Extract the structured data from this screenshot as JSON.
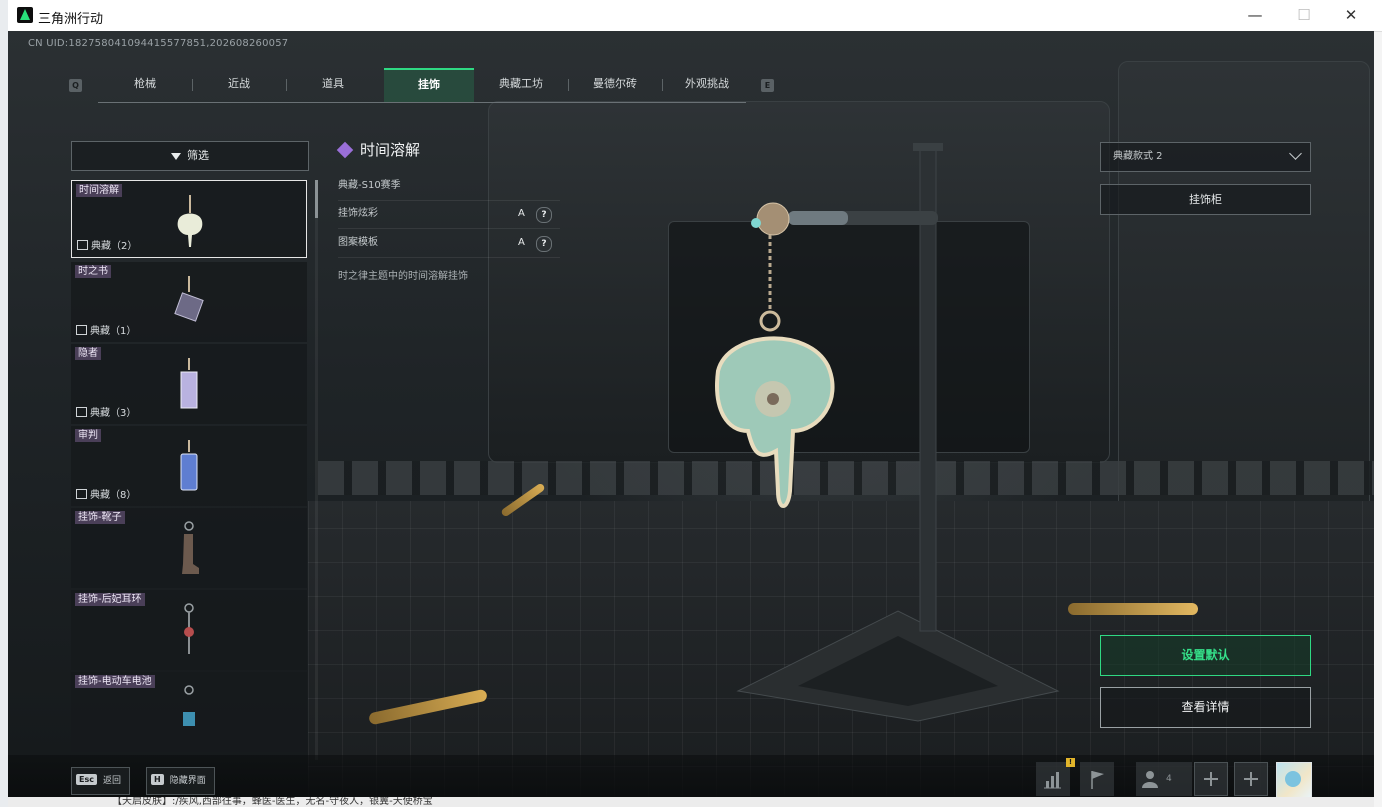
{
  "window": {
    "title": "三角洲行动",
    "minimize_glyph": "—",
    "maximize_glyph": "☐",
    "close_glyph": "✕"
  },
  "uid": "CN UID:1827580410944155778​51,202608260057",
  "tabs": {
    "left_key": "Q",
    "right_key": "E",
    "items": [
      {
        "label": "枪械"
      },
      {
        "label": "近战"
      },
      {
        "label": "道具"
      },
      {
        "label": "挂饰"
      },
      {
        "label": "典藏工坊"
      },
      {
        "label": "曼德尔砖"
      },
      {
        "label": "外观挑战"
      }
    ],
    "active_index": 3
  },
  "filter": {
    "label": "筛选"
  },
  "list": {
    "items": [
      {
        "name": "时间溶解",
        "tag": "典藏（2）"
      },
      {
        "name": "时之书",
        "tag": "典藏（1）"
      },
      {
        "name": "隐者",
        "tag": "典藏（3）"
      },
      {
        "name": "审判",
        "tag": "典藏（8）"
      },
      {
        "name": "挂饰-靴子",
        "tag": ""
      },
      {
        "name": "挂饰-后妃耳环",
        "tag": ""
      },
      {
        "name": "挂饰-电动车电池",
        "tag": ""
      }
    ],
    "selected_index": 0
  },
  "detail": {
    "title": "时间溶解",
    "season": "典藏-S10赛季",
    "rows": [
      {
        "label": "挂饰炫彩",
        "value": "A",
        "help": "?"
      },
      {
        "label": "图案模板",
        "value": "A",
        "help": "?"
      }
    ],
    "description": "时之律主题中的时间溶解挂饰"
  },
  "right_panel": {
    "variant_value": "典藏款式 2",
    "cabinet_label": "挂饰柜",
    "set_default_label": "设置默认",
    "view_details_label": "查看详情"
  },
  "bottom": {
    "back_key": "Esc",
    "back_label": "返回",
    "hide_key": "H",
    "hide_label": "隐藏界面",
    "warn_badge": "!",
    "friend_count": "4"
  },
  "underlying_text": "【天启皮肤】:/疾风,西部往事，蜂医-医生，无名-守夜人，银翼-天使桥宝",
  "colors": {
    "accent_green": "#2fd983",
    "name_tag_purple": "#4a3f58",
    "diamond_purple": "#9a6fd8"
  }
}
